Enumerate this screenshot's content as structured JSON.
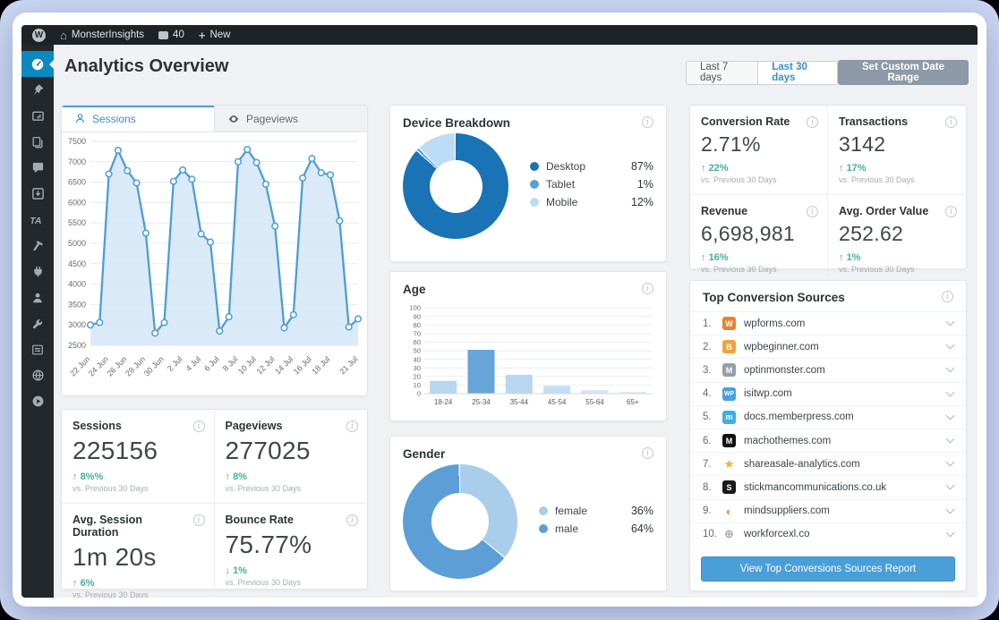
{
  "admin_bar": {
    "site": "MonsterInsights",
    "comments": "40",
    "new_label": "New"
  },
  "sidebar": {
    "items": [
      {
        "name": "monsterinsights",
        "icon": "gauge",
        "active": true
      },
      {
        "name": "posts-pin",
        "icon": "pin",
        "active": false
      },
      {
        "name": "media",
        "icon": "media",
        "active": false
      },
      {
        "name": "pages",
        "icon": "pages",
        "active": false
      },
      {
        "name": "comments",
        "icon": "comment",
        "active": false
      },
      {
        "name": "downloads",
        "icon": "download",
        "active": false
      },
      {
        "name": "ta",
        "icon": "ta",
        "active": false
      },
      {
        "name": "appearance",
        "icon": "hammer",
        "active": false
      },
      {
        "name": "plugins",
        "icon": "plug",
        "active": false
      },
      {
        "name": "users",
        "icon": "user",
        "active": false
      },
      {
        "name": "tools",
        "icon": "wrench",
        "active": false
      },
      {
        "name": "settings",
        "icon": "sliders",
        "active": false
      },
      {
        "name": "network",
        "icon": "globe",
        "active": false
      },
      {
        "name": "video",
        "icon": "play",
        "active": false
      }
    ]
  },
  "header": {
    "title": "Analytics Overview",
    "range_7": "Last 7 days",
    "range_30": "Last 30 days",
    "custom_range": "Set Custom Date Range"
  },
  "tabs": {
    "sessions": "Sessions",
    "pageviews": "Pageviews"
  },
  "kpis_right": [
    {
      "label": "Conversion Rate",
      "value": "2.71%",
      "trend": "22%",
      "direction": "up",
      "compare": "vs. Previous 30 Days"
    },
    {
      "label": "Transactions",
      "value": "3142",
      "trend": "17%",
      "direction": "up",
      "compare": "vs. Previous 30 Days"
    },
    {
      "label": "Revenue",
      "value": "6,698,981",
      "trend": "16%",
      "direction": "up",
      "compare": "vs. Previous 30 Days"
    },
    {
      "label": "Avg. Order Value",
      "value": "252.62",
      "trend": "1%",
      "direction": "up",
      "compare": "vs. Previous 30 Days"
    }
  ],
  "kpis_left": [
    {
      "label": "Sessions",
      "value": "225156",
      "trend": "8%%",
      "direction": "up",
      "compare": "vs. Previous 30 Days"
    },
    {
      "label": "Pageviews",
      "value": "277025",
      "trend": "8%",
      "direction": "up",
      "compare": "vs. Previous 30 Days"
    },
    {
      "label": "Avg. Session Duration",
      "value": "1m 20s",
      "trend": "6%",
      "direction": "up",
      "compare": "vs. Previous 30 Days"
    },
    {
      "label": "Bounce Rate",
      "value": "75.77%",
      "trend": "1%",
      "direction": "down",
      "compare": "vs. Previous 30 Days"
    }
  ],
  "sources": {
    "title": "Top Conversion Sources",
    "button": "View Top Conversions Sources Report",
    "items": [
      {
        "rank": "1.",
        "domain": "wpforms.com",
        "favicon": {
          "bg": "#e8832e",
          "fg": "#ffffff",
          "label": "W"
        }
      },
      {
        "rank": "2.",
        "domain": "wpbeginner.com",
        "favicon": {
          "bg": "#f0a33a",
          "fg": "#ffffff",
          "label": "B"
        }
      },
      {
        "rank": "3.",
        "domain": "optinmonster.com",
        "favicon": {
          "bg": "#94a0a6",
          "fg": "#ffffff",
          "label": "M"
        }
      },
      {
        "rank": "4.",
        "domain": "isitwp.com",
        "favicon": {
          "bg": "#47a0dc",
          "fg": "#ffffff",
          "label": "WP"
        }
      },
      {
        "rank": "5.",
        "domain": "docs.memberpress.com",
        "favicon": {
          "bg": "#3cb0e2",
          "fg": "#ffffff",
          "label": "m"
        }
      },
      {
        "rank": "6.",
        "domain": "machothemes.com",
        "favicon": {
          "bg": "#111111",
          "fg": "#ffffff",
          "label": "M"
        }
      },
      {
        "rank": "7.",
        "domain": "shareasale-analytics.com",
        "favicon": {
          "glyph": "★",
          "color": "#f2b028"
        }
      },
      {
        "rank": "8.",
        "domain": "stickmancommunications.co.uk",
        "favicon": {
          "bg": "#1a1a1a",
          "fg": "#ffffff",
          "label": "S"
        }
      },
      {
        "rank": "9.",
        "domain": "mindsuppliers.com",
        "favicon": {
          "glyph": "◐",
          "color": "#f0922e"
        }
      },
      {
        "rank": "10.",
        "domain": "workforcexl.co",
        "favicon": {
          "glyph": "⊕",
          "color": "#9aa0a6"
        }
      }
    ]
  },
  "chart_data": [
    {
      "id": "sessions_trend",
      "type": "line",
      "title": "Sessions",
      "ylim": [
        2500,
        7500
      ],
      "ytick_step": 500,
      "x_tick_labels": [
        "22 Jun",
        "24 Jun",
        "26 Jun",
        "28 Jun",
        "30 Jun",
        "2 Jul",
        "4 Jul",
        "6 Jul",
        "8 Jul",
        "10 Jul",
        "12 Jul",
        "14 Jul",
        "16 Jul",
        "18 Jul",
        "21 Jul"
      ],
      "x_tick_positions": [
        0,
        2,
        4,
        6,
        8,
        10,
        12,
        14,
        16,
        18,
        20,
        22,
        24,
        26,
        29
      ],
      "values": [
        3000,
        3060,
        6700,
        7280,
        6780,
        6480,
        5250,
        2800,
        3060,
        6520,
        6800,
        6570,
        5230,
        5030,
        2850,
        3200,
        7000,
        7300,
        6980,
        6450,
        5420,
        2930,
        3250,
        6600,
        7080,
        6730,
        6680,
        5550,
        2950,
        3150
      ],
      "line_color": "#4e9ed6",
      "fill_color": "#d7e8f7",
      "grid": true,
      "legend": "none"
    },
    {
      "id": "device_breakdown",
      "type": "pie",
      "title": "Device Breakdown",
      "labels": [
        "Desktop",
        "Tablet",
        "Mobile"
      ],
      "values": [
        87,
        1,
        12
      ],
      "display_values": [
        "87%",
        "1%",
        "12%"
      ],
      "colors": [
        "#1a73b5",
        "#57a1d8",
        "#bcdcf5"
      ],
      "legend_position": "right"
    },
    {
      "id": "age",
      "type": "bar",
      "title": "Age",
      "categories": [
        "18-24",
        "25-34",
        "35-44",
        "45-54",
        "55-64",
        "65+"
      ],
      "values": [
        15,
        51,
        22,
        9,
        4,
        2
      ],
      "ylim": [
        0,
        100
      ],
      "ytick_step": 10,
      "colors": [
        "#b7d7f0",
        "#67a4d8",
        "#b7d7f0",
        "#c6def2",
        "#d3e5f5",
        "#dceaf7"
      ],
      "grid": true
    },
    {
      "id": "gender",
      "type": "pie",
      "title": "Gender",
      "labels": [
        "female",
        "male"
      ],
      "values": [
        36,
        64
      ],
      "display_values": [
        "36%",
        "64%"
      ],
      "colors": [
        "#a9cdeb",
        "#5b9fd6"
      ],
      "legend_position": "right"
    }
  ]
}
